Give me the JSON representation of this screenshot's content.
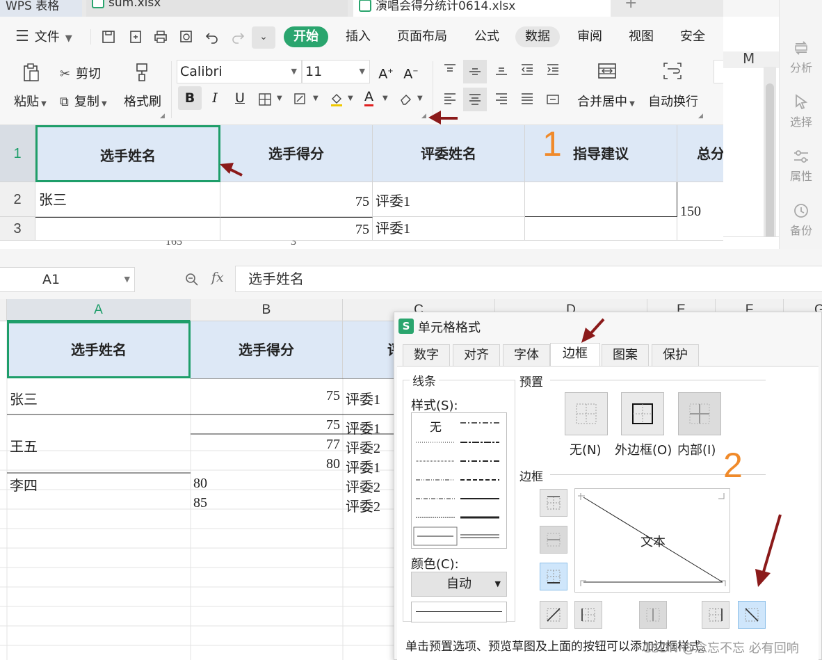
{
  "tabs": {
    "tab1": "WPS 表格",
    "tab2": "sum.xlsx",
    "tab3": "演唱会得分统计0614.xlsx",
    "plus": "+"
  },
  "menu": {
    "file": "文件",
    "start": "开始",
    "insert": "插入",
    "layout": "页面布局",
    "formula": "公式",
    "data": "数据",
    "review": "审阅",
    "view": "视图",
    "security": "安全"
  },
  "ribbon": {
    "paste": "粘贴",
    "cut": "剪切",
    "copy": "复制",
    "format_painter": "格式刷",
    "font_name": "Calibri",
    "font_size": "11",
    "merge_center": "合并居中",
    "auto_wrap": "自动换行"
  },
  "right_rail": {
    "analysis": "分析",
    "select": "选择",
    "properties": "属性",
    "backup": "备份",
    "col_m": "M"
  },
  "top_grid": {
    "row_numbers": [
      "1",
      "2",
      "3"
    ],
    "headers": [
      "选手姓名",
      "选手得分",
      "评委姓名",
      "指导建议",
      "总分"
    ],
    "row2": [
      "张三",
      "75",
      "评委1",
      "",
      "150"
    ],
    "row3": [
      "",
      "75",
      "评委1",
      ""
    ],
    "peek_row": [
      "165",
      "3"
    ]
  },
  "formula_bar": {
    "name_box": "A1",
    "fx": "fx",
    "content": "选手姓名"
  },
  "columns": [
    "A",
    "B",
    "C",
    "D",
    "E",
    "F",
    "G"
  ],
  "bottom_grid": {
    "headers": [
      "选手姓名",
      "选手得分",
      "评"
    ],
    "rows": [
      {
        "a": "张三",
        "b": "75",
        "c": "评委1"
      },
      {
        "a": "",
        "b": "75",
        "c": "评委1"
      },
      {
        "a": "王五",
        "b": "77",
        "c": "评委2"
      },
      {
        "a": "",
        "b": "80",
        "c": "评委1"
      },
      {
        "a": "李四",
        "b": "80",
        "c": "评委2"
      },
      {
        "a": "",
        "b": "85",
        "c": "评委2"
      }
    ]
  },
  "dialog": {
    "title": "单元格格式",
    "tabs": [
      "数字",
      "对齐",
      "字体",
      "边框",
      "图案",
      "保护"
    ],
    "active_tab": "边框",
    "line_group": "线条",
    "style_label": "样式(S):",
    "style_none": "无",
    "color_label": "颜色(C):",
    "color_value": "自动",
    "preset_group": "预置",
    "preset_none": "无(N)",
    "preset_outline": "外边框(O)",
    "preset_inside": "内部(I)",
    "border_group": "边框",
    "preview_text": "文本",
    "hint": "单击预置选项、预览草图及上面的按钮可以添加边框样式。"
  },
  "annotations": {
    "num1": "1",
    "num2": "2",
    "watermark": "CSDN @念忘不忘  必有回响"
  },
  "colors": {
    "accent_green": "#2aa56e",
    "header_blue": "#dde8f6",
    "annotation_orange": "#f08a2a",
    "annotation_arrow": "#8b1a1a",
    "selection_green": "#1e9e6a"
  }
}
